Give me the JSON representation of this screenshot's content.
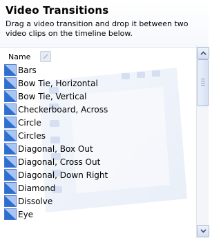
{
  "panel": {
    "title": "Video Transitions",
    "description": "Drag a video transition and drop it between two video clips on the timeline below."
  },
  "list": {
    "column_header": "Name",
    "items": [
      {
        "label": "Bars"
      },
      {
        "label": "Bow Tie, Horizontal"
      },
      {
        "label": "Bow Tie, Vertical"
      },
      {
        "label": "Checkerboard, Across"
      },
      {
        "label": "Circle"
      },
      {
        "label": "Circles"
      },
      {
        "label": "Diagonal, Box Out"
      },
      {
        "label": "Diagonal, Cross Out"
      },
      {
        "label": "Diagonal, Down Right"
      },
      {
        "label": "Diamond"
      },
      {
        "label": "Dissolve"
      },
      {
        "label": "Eye"
      }
    ]
  },
  "icons": {
    "sort": "sort-icon",
    "item": "transition-icon",
    "scroll_up": "chevron-up-icon",
    "scroll_down": "chevron-down-icon"
  },
  "colors": {
    "icon_blue": "#2f6fd0",
    "icon_light": "#a9c6f3"
  }
}
